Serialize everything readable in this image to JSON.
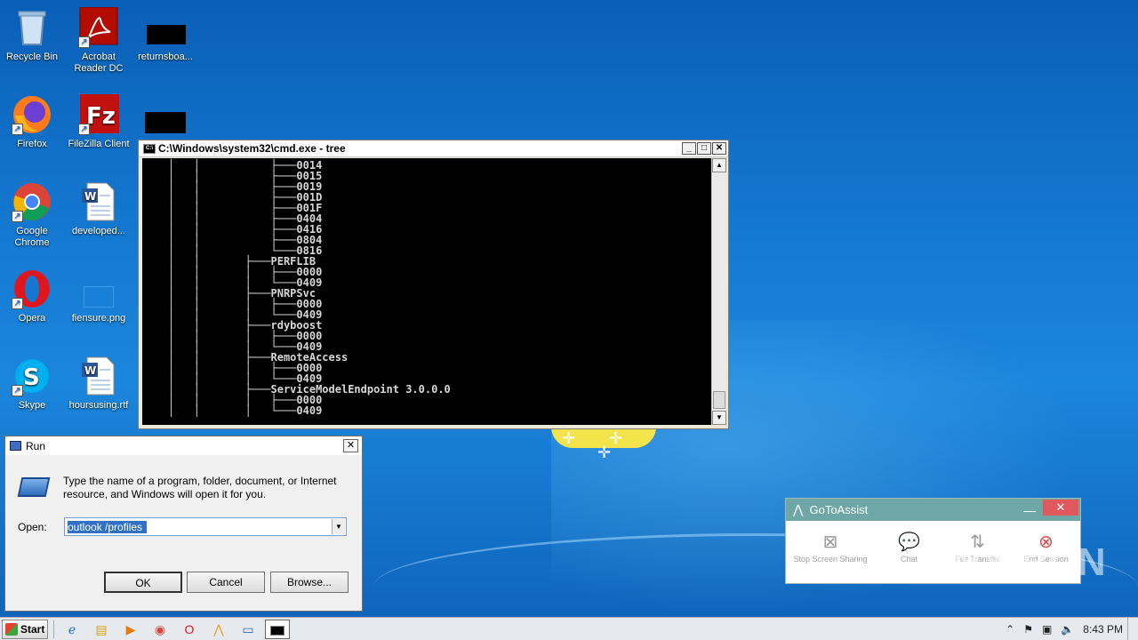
{
  "desktop": {
    "icons": [
      {
        "label": "Recycle Bin",
        "icon": "recycle-bin-icon"
      },
      {
        "label": "Acrobat Reader DC",
        "icon": "acrobat-icon"
      },
      {
        "label": "returnsboa...",
        "icon": "file-icon"
      },
      {
        "label": "Firefox",
        "icon": "firefox-icon"
      },
      {
        "label": "FileZilla Client",
        "icon": "filezilla-icon"
      },
      {
        "label": "Google Chrome",
        "icon": "chrome-icon"
      },
      {
        "label": "developed...",
        "icon": "word-doc-icon"
      },
      {
        "label": "Opera",
        "icon": "opera-icon"
      },
      {
        "label": "fiensure.png",
        "icon": "image-icon"
      },
      {
        "label": "Skype",
        "icon": "skype-icon"
      },
      {
        "label": "hoursusing.rtf",
        "icon": "word-doc-icon"
      }
    ]
  },
  "cmd": {
    "title": "C:\\Windows\\system32\\cmd.exe - tree",
    "lines": [
      "│   │           ├───0014",
      "│   │           ├───0015",
      "│   │           ├───0019",
      "│   │           ├───001D",
      "│   │           ├───001F",
      "│   │           ├───0404",
      "│   │           ├───0416",
      "│   │           ├───0804",
      "│   │           └───0816",
      "│   │       ├───PERFLIB",
      "│   │       │   ├───0000",
      "│   │       │   └───0409",
      "│   │       ├───PNRPSvc",
      "│   │       │   ├───0000",
      "│   │       │   └───0409",
      "│   │       ├───rdyboost",
      "│   │       │   ├───0000",
      "│   │       │   └───0409",
      "│   │       ├───RemoteAccess",
      "│   │       │   ├───0000",
      "│   │       │   └───0409",
      "│   │       ├───ServiceModelEndpoint 3.0.0.0",
      "│   │       │   ├───0000",
      "│   │       │   └───0409"
    ]
  },
  "run": {
    "title": "Run",
    "description": "Type the name of a program, folder, document, or Internet resource, and Windows will open it for you.",
    "open_label": "Open:",
    "open_value": "outlook /profiles",
    "ok_label": "OK",
    "cancel_label": "Cancel",
    "browse_label": "Browse..."
  },
  "gotoassist": {
    "title": "GoToAssist",
    "tools": [
      {
        "label": "Stop Screen Sharing",
        "icon": "stop-screen-share-icon"
      },
      {
        "label": "Chat",
        "icon": "chat-icon"
      },
      {
        "label": "File Transfer",
        "icon": "file-transfer-icon"
      },
      {
        "label": "End Session",
        "icon": "end-session-icon"
      }
    ]
  },
  "watermark": "ANY RUN",
  "taskbar": {
    "start_label": "Start",
    "clock": "8:43 PM"
  }
}
